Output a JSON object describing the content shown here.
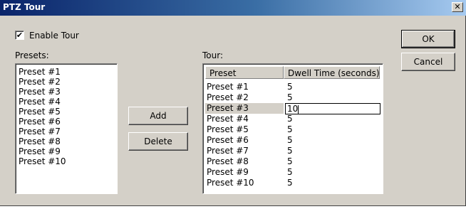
{
  "window": {
    "title": "PTZ Tour",
    "close_glyph": "✕"
  },
  "enable_tour": {
    "label": "Enable Tour",
    "checked": true,
    "check_glyph": "✔"
  },
  "presets": {
    "label": "Presets:",
    "items": [
      "Preset #1",
      "Preset #2",
      "Preset #3",
      "Preset #4",
      "Preset #5",
      "Preset #6",
      "Preset #7",
      "Preset #8",
      "Preset #9",
      "Preset #10"
    ]
  },
  "buttons": {
    "add": "Add",
    "delete": "Delete",
    "ok": "OK",
    "cancel": "Cancel"
  },
  "tour": {
    "label": "Tour:",
    "columns": [
      "Preset",
      "Dwell Time (seconds)"
    ],
    "selected_row": 2,
    "rows": [
      {
        "preset": "Preset #1",
        "dwell": "5"
      },
      {
        "preset": "Preset #2",
        "dwell": "5"
      },
      {
        "preset": "Preset #3",
        "dwell": "10"
      },
      {
        "preset": "Preset #4",
        "dwell": "5"
      },
      {
        "preset": "Preset #5",
        "dwell": "5"
      },
      {
        "preset": "Preset #6",
        "dwell": "5"
      },
      {
        "preset": "Preset #7",
        "dwell": "5"
      },
      {
        "preset": "Preset #8",
        "dwell": "5"
      },
      {
        "preset": "Preset #9",
        "dwell": "5"
      },
      {
        "preset": "Preset #10",
        "dwell": "5"
      }
    ]
  }
}
